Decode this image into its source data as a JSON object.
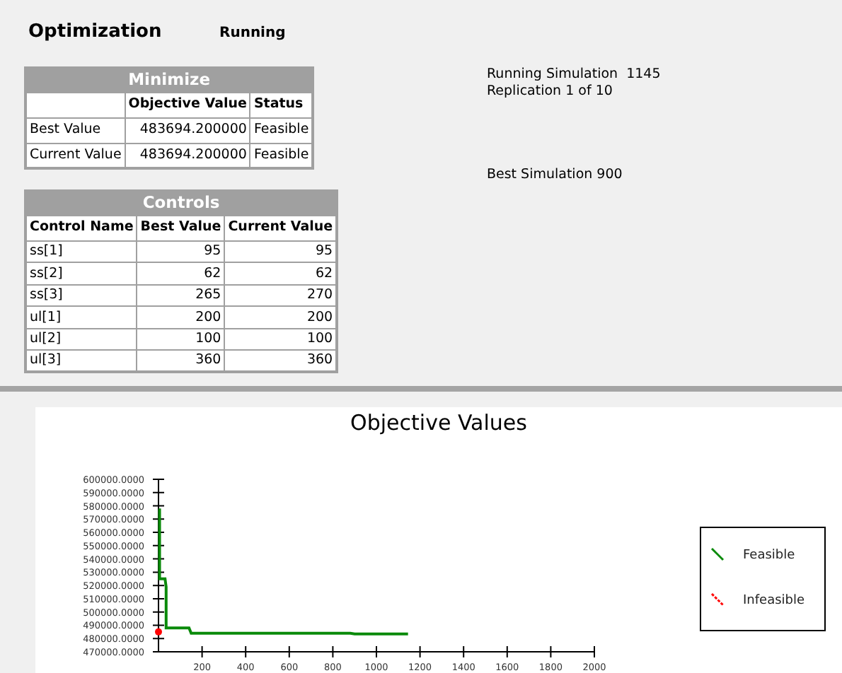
{
  "header": {
    "title": "Optimization",
    "status": "Running"
  },
  "minimize": {
    "title": "Minimize",
    "columns": [
      "Objective Value",
      "Status"
    ],
    "rows": [
      {
        "label": "Best Value",
        "objective": "483694.200000",
        "status": "Feasible"
      },
      {
        "label": "Current Value",
        "objective": "483694.200000",
        "status": "Feasible"
      }
    ]
  },
  "controls": {
    "title": "Controls",
    "columns": [
      "Control Name",
      "Best Value",
      "Current Value"
    ],
    "rows": [
      [
        "ss[1]",
        "95",
        "95"
      ],
      [
        "ss[2]",
        "62",
        "62"
      ],
      [
        "ss[3]",
        "265",
        "270"
      ],
      [
        "ul[1]",
        "200",
        "200"
      ],
      [
        "ul[2]",
        "100",
        "100"
      ],
      [
        "ul[3]",
        "360",
        "360"
      ]
    ]
  },
  "info": {
    "running": "Running Simulation  1145",
    "replication": "Replication 1 of 10",
    "best": "Best Simulation 900"
  },
  "chart": {
    "chart_data": {
      "type": "line",
      "title": "Objective Values",
      "x": [
        0,
        5,
        5,
        30,
        35,
        35,
        140,
        150,
        880,
        900,
        1145
      ],
      "series": [
        {
          "name": "Feasible",
          "color": "#0a8a0a",
          "values": [
            577000,
            577000,
            525000,
            525000,
            519000,
            488000,
            488000,
            484000,
            484000,
            483500,
            483500
          ]
        },
        {
          "name": "Infeasible",
          "color": "#ff0000",
          "marker": "circle",
          "values": [
            485000,
            null,
            null,
            null,
            null,
            null,
            null,
            null,
            null,
            null,
            null
          ]
        }
      ],
      "legend": "right",
      "xlim": [
        0,
        2000
      ],
      "ylim": [
        470000,
        600000
      ],
      "xticks": [
        200,
        400,
        600,
        800,
        1000,
        1200,
        1400,
        1600,
        1800,
        2000
      ],
      "yticks": [
        {
          "value": 600000,
          "label": "600000.0000"
        },
        {
          "value": 590000,
          "label": "590000.0000"
        },
        {
          "value": 580000,
          "label": "580000.0000"
        },
        {
          "value": 570000,
          "label": "570000.0000"
        },
        {
          "value": 560000,
          "label": "560000.0000"
        },
        {
          "value": 550000,
          "label": "550000.0000"
        },
        {
          "value": 540000,
          "label": "540000.0000"
        },
        {
          "value": 530000,
          "label": "530000.0000"
        },
        {
          "value": 520000,
          "label": "520000.0000"
        },
        {
          "value": 510000,
          "label": "510000.0000"
        },
        {
          "value": 500000,
          "label": "500000.0000"
        },
        {
          "value": 490000,
          "label": "490000.0000"
        },
        {
          "value": 480000,
          "label": "480000.0000"
        },
        {
          "value": 470000,
          "label": "470000.0000"
        }
      ]
    }
  }
}
